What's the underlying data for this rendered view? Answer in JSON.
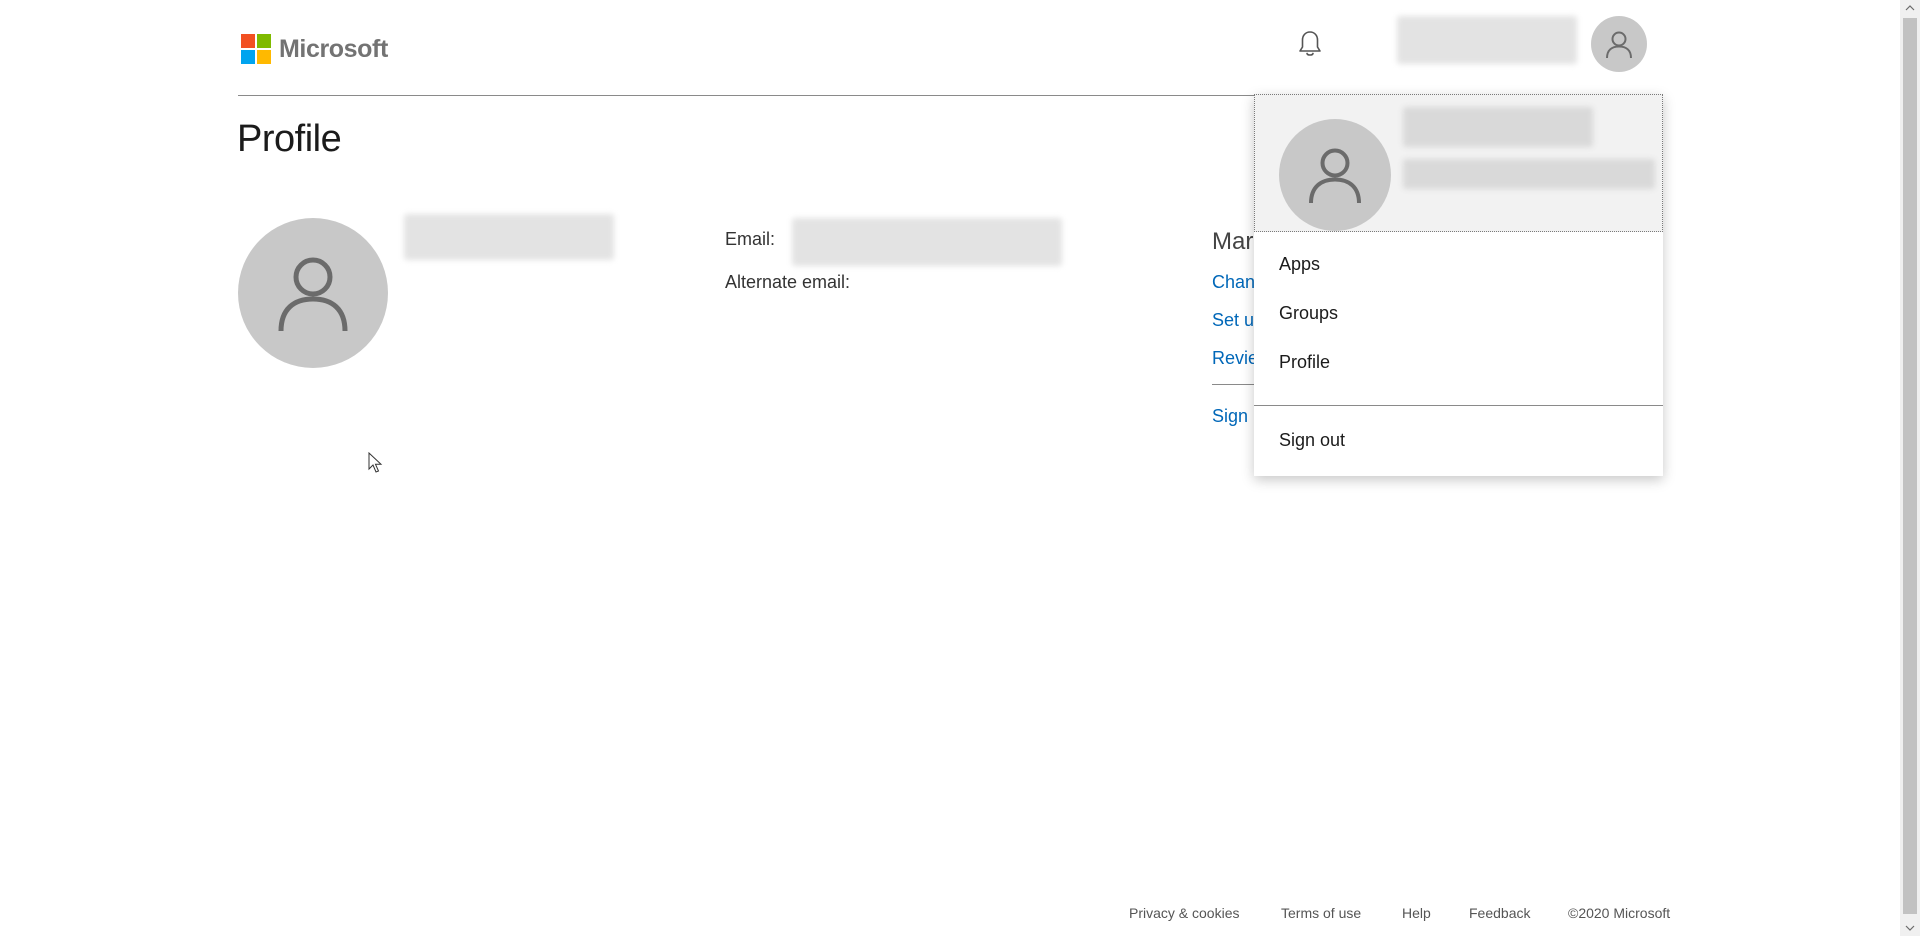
{
  "header": {
    "brand": "Microsoft",
    "logo_colors": [
      "#f25022",
      "#7fba00",
      "#00a4ef",
      "#ffb900"
    ]
  },
  "page": {
    "title": "Profile"
  },
  "profile": {
    "email_label": "Email:",
    "alternate_email_label": "Alternate email:"
  },
  "manage": {
    "heading": "Mar",
    "links": [
      "Chan",
      "Set u",
      "Revie",
      "Sign"
    ]
  },
  "dropdown": {
    "items": [
      "Apps",
      "Groups",
      "Profile"
    ],
    "sign_out": "Sign out"
  },
  "footer": {
    "links": [
      "Privacy & cookies",
      "Terms of use",
      "Help",
      "Feedback"
    ],
    "copyright": "©2020 Microsoft"
  },
  "colors": {
    "link": "#0067b8",
    "avatar_bg": "#c8c8c8",
    "avatar_fg": "#6b6b6b"
  },
  "icons": {
    "notification": "bell-icon",
    "account": "person-icon"
  }
}
